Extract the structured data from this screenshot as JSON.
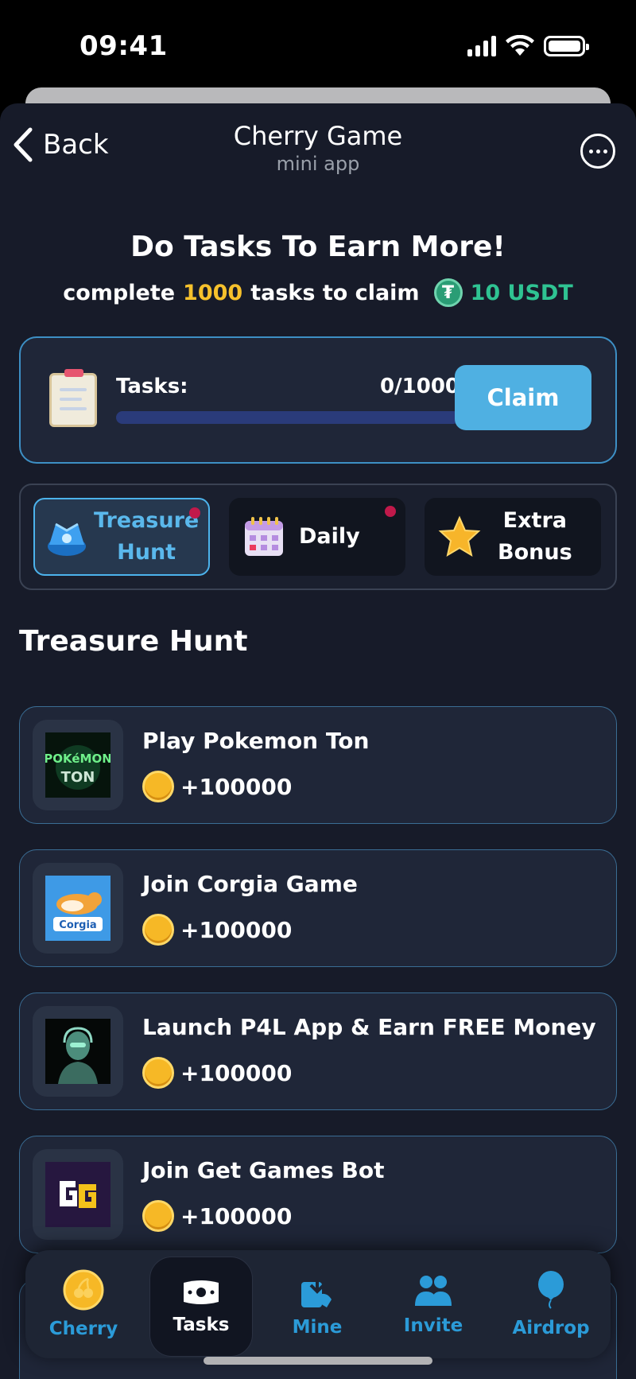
{
  "status_bar": {
    "time": "09:41"
  },
  "header": {
    "back_label": "Back",
    "title": "Cherry Game",
    "subtitle": "mini app"
  },
  "hero": {
    "title": "Do Tasks To Earn More!",
    "sub_prefix": "complete",
    "sub_count": "1000",
    "sub_middle": "tasks to claim",
    "sub_reward": "10 USDT",
    "accent_color": "#f6c12c",
    "usdt_color": "#2fc392"
  },
  "progress": {
    "label": "Tasks:",
    "count": "0/1000",
    "fraction": 0,
    "claim_label": "Claim"
  },
  "tabs": [
    {
      "line1": "Treasure",
      "line2": "Hunt",
      "active": true,
      "dot": true,
      "icon": "treasure-chest-icon"
    },
    {
      "line1": "Daily",
      "line2": "",
      "active": false,
      "dot": true,
      "icon": "calendar-icon"
    },
    {
      "line1": "Extra",
      "line2": "Bonus",
      "active": false,
      "dot": false,
      "icon": "star-icon"
    }
  ],
  "section_title": "Treasure Hunt",
  "tasks": [
    {
      "name": "Play Pokemon Ton",
      "reward": "+100000",
      "thumb": "pokemon-ton-logo"
    },
    {
      "name": "Join Corgia Game",
      "reward": "+100000",
      "thumb": "corgia-logo"
    },
    {
      "name": "Launch P4L App & Earn FREE Money",
      "reward": "+100000",
      "thumb": "p4l-robot-logo"
    },
    {
      "name": "Join Get Games Bot",
      "reward": "+100000",
      "thumb": "get-games-logo"
    }
  ],
  "nav": [
    {
      "label": "Cherry",
      "icon": "cherry-coin-icon",
      "active": false
    },
    {
      "label": "Tasks",
      "icon": "ticket-icon",
      "active": true
    },
    {
      "label": "Mine",
      "icon": "mine-icon",
      "active": false
    },
    {
      "label": "Invite",
      "icon": "invite-icon",
      "active": false
    },
    {
      "label": "Airdrop",
      "icon": "airdrop-balloon-icon",
      "active": false
    }
  ],
  "colors": {
    "background": "#171b29",
    "card": "#1f2638",
    "accent_blue": "#4fb0e2"
  }
}
